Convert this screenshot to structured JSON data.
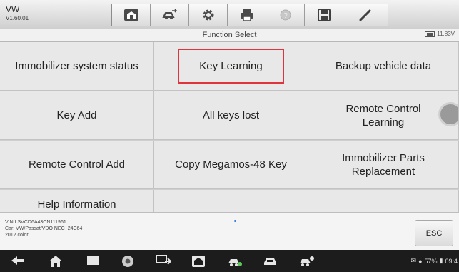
{
  "header": {
    "brand": "VW",
    "version": "V1.60.01",
    "toolbar": [
      "home-icon",
      "vehicle-swap-icon",
      "settings-icon",
      "print-icon",
      "help-icon",
      "save-icon",
      "pen-icon"
    ]
  },
  "title_bar": {
    "title": "Function Select",
    "voltage": "11.83V"
  },
  "functions": [
    "Immobilizer system status",
    "Key Learning",
    "Backup vehicle data",
    "Key Add",
    "All keys lost",
    "Remote Control Learning",
    "Remote Control Add",
    "Copy Megamos-48 Key",
    "Immobilizer Parts Replacement",
    "Help Information",
    "",
    ""
  ],
  "selected_function": "Key Learning",
  "vehicle_info": {
    "vin": "VIN:LSVCD6A43CN111961",
    "car": "Car: VW/Passat/VDO NEC+24C64",
    "color": "2012 color"
  },
  "esc_label": "ESC",
  "system_bar": {
    "icons": [
      "back-icon",
      "home-icon",
      "recent-apps-icon",
      "chrome-icon",
      "screenshot-icon",
      "autel-home-icon",
      "vehicle-icon",
      "car-icon",
      "car-user-icon"
    ],
    "battery": "57%",
    "time": "09:4"
  },
  "colors": {
    "selection_border": "#e0343c",
    "toolbar_bg": "#dcdcdc",
    "navbar_bg": "#1c1c1c"
  }
}
